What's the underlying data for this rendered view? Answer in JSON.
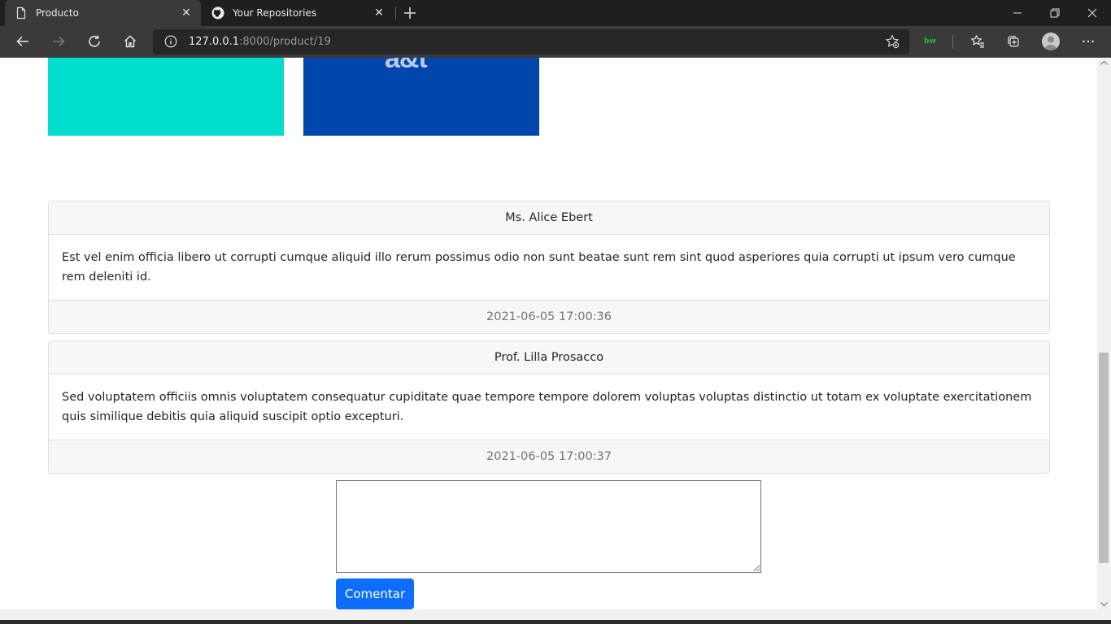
{
  "browser": {
    "tabs": [
      {
        "title": "Producto",
        "icon": "page-icon",
        "active": true
      },
      {
        "title": "Your Repositories",
        "icon": "github-icon",
        "active": false
      }
    ],
    "address": {
      "host": "127.0.0.1",
      "rest": ":8000/product/19"
    }
  },
  "comments": [
    {
      "author": "Ms. Alice Ebert",
      "body": "Est vel enim officia libero ut corrupti cumque aliquid illo rerum possimus odio non sunt beatae sunt rem sint quod asperiores quia corrupti ut ipsum vero cumque rem deleniti id.",
      "date": "2021-06-05 17:00:36"
    },
    {
      "author": "Prof. Lilla Prosacco",
      "body": "Sed voluptatem officiis omnis voluptatem consequatur cupiditate quae tempore tempore dolorem voluptas voluptas distinctio ut totam ex voluptate exercitationem quis similique debitis quia aliquid suscipit optio excepturi.",
      "date": "2021-06-05 17:00:37"
    }
  ],
  "form": {
    "comment_value": "",
    "submit_label": "Comentar"
  },
  "colors": {
    "accent": "#0d6efd",
    "product_image_1": "#00ddcc",
    "product_image_2": "#0046ad"
  }
}
